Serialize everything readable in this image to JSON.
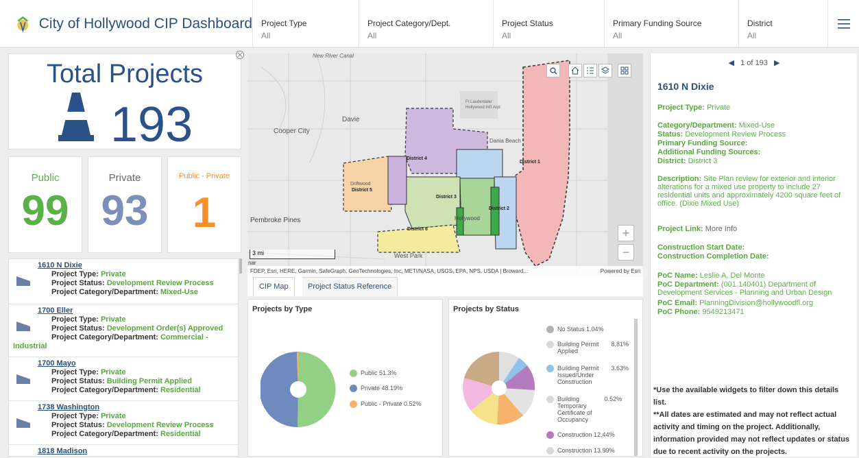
{
  "header": {
    "title": "City of Hollywood CIP Dashboard",
    "filters": [
      {
        "label": "Project Type",
        "value": "All"
      },
      {
        "label": "Project Category/Dept.",
        "value": "All"
      },
      {
        "label": "Project Status",
        "value": "All"
      },
      {
        "label": "Primary Funding Source",
        "value": "All"
      },
      {
        "label": "District",
        "value": "All"
      }
    ]
  },
  "total": {
    "title": "Total Projects",
    "count": "193"
  },
  "categories": [
    {
      "label": "Public",
      "value": "99",
      "color": "#5cb048"
    },
    {
      "label": "Private",
      "value": "93",
      "color": "#7b8fb8"
    },
    {
      "label": "Public - Private",
      "value": "1",
      "color": "#f5922b"
    }
  ],
  "projects": [
    {
      "name": "1610 N Dixie",
      "type": "Private",
      "status": "Development Review Process",
      "category": "Mixed-Use"
    },
    {
      "name": "1700 Eller",
      "type": "Private",
      "status": "Development Order(s) Approved",
      "category": "Commercial - Industrial"
    },
    {
      "name": "1700 Mayo",
      "type": "Private",
      "status": "Building Permit Applied",
      "category": "Residential"
    },
    {
      "name": "1738 Washington",
      "type": "Private",
      "status": "Development Review Process",
      "category": "Residential"
    },
    {
      "name": "1818 Madison",
      "type": "",
      "status": "",
      "category": ""
    }
  ],
  "list_labels": {
    "type": "Project Type: ",
    "status": "Project Status: ",
    "category": "Project Category/Department: "
  },
  "map": {
    "scale": "3 mi",
    "attribution": "FDEP, Esri, HERE, Garmin, SafeGraph, GeoTechnologies, Inc, METI/NASA, USGS, EPA, NPS, USDA | Broward...",
    "powered": "Powered by Esri",
    "places": [
      "New River Canal",
      "Davie",
      "Cooper City",
      "Ft Lauderdale/ Hollywood Int'l Arpt",
      "Dania Beach",
      "Pembroke Pines",
      "West Park",
      "Driftwood",
      "Hollywood",
      "nar"
    ],
    "districts": [
      "District 1",
      "District 2",
      "District 3",
      "District 4",
      "District 5",
      "District 6"
    ],
    "zoom_in": "+",
    "zoom_out": "−"
  },
  "map_tabs": [
    "CIP Map",
    "Project Status Reference"
  ],
  "by_type": {
    "title": "Projects by Type",
    "legend": [
      {
        "label": "Public",
        "pct": "51.3%",
        "color": "#92d084"
      },
      {
        "label": "Private",
        "pct": "48.19%",
        "color": "#6f8bbd"
      },
      {
        "label": "Public - Private",
        "pct": "0.52%",
        "color": "#f7b26b"
      }
    ]
  },
  "by_status": {
    "title": "Projects by Status",
    "legend": [
      {
        "label": "No Status",
        "pct": "1.04%",
        "color": "#b3b3b3"
      },
      {
        "label": "Building Permit Applied",
        "pct": "8.81%",
        "color": "#d9d9d9"
      },
      {
        "label": "Building Permit Issued/Under Construction",
        "pct": "3.63%",
        "color": "#8fc3e8"
      },
      {
        "label": "Building Temporary Certificate of Occupancy",
        "pct": "0.52%",
        "color": "#d9d9d9"
      },
      {
        "label": "Construction",
        "pct": "12.44%",
        "color": "#b57bbf"
      },
      {
        "label": "Construction",
        "pct": "13.99%",
        "color": "#d9d9d9"
      }
    ]
  },
  "detail": {
    "pager": "1 of 193",
    "title": "1610 N Dixie",
    "type_label": "Project Type:",
    "type_value": "Private",
    "cat_label": "Category/Department:",
    "cat_value": "Mixed-Use",
    "status_label": "Status:",
    "status_value": "Development Review Process",
    "pfs_label": "Primary Funding Source:",
    "afs_label": "Additional Funding Sources:",
    "district_label": "District:",
    "district_value": "District 3",
    "desc_label": "Description:",
    "desc_value": "Site Plan review for exterior and interior alterations for a mixed use property to include 27 residential units and approximately 4200 square feet of office. (Dixie Mixed Use)",
    "link_label": "Project Link:",
    "link_value": "More Info",
    "start_label": "Construction Start Date:",
    "end_label": "Construction Completion Date:",
    "poc_name_label": "PoC Name:",
    "poc_name": "Leslie A. Del Monte",
    "poc_dept_label": "PoC Department:",
    "poc_dept": "(001.140401) Department of Development Services - Planning and Urban Design",
    "poc_email_label": "PoC Email:",
    "poc_email": "PlanningDivision@hollywoodfl.org",
    "poc_phone_label": "PoC Phone:",
    "poc_phone": "9549213471",
    "note1": "*Use the available widgets to filter down this details list.",
    "note2": "**All dates are estimated and may not reflect actual activity and timing on the project. Additionally, information provided may not reflect updates or status due to recent activity on the projects."
  }
}
